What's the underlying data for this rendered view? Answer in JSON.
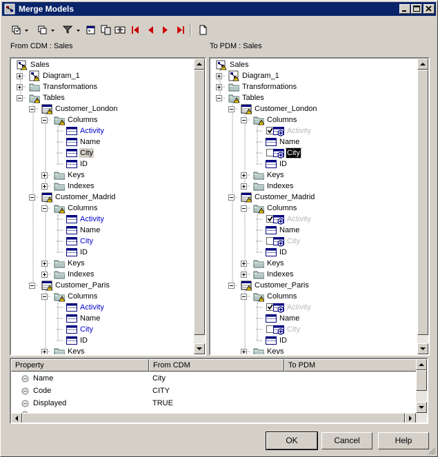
{
  "window": {
    "title": "Merge Models"
  },
  "panes": {
    "left_label": "From CDM : Sales",
    "right_label": "To PDM : Sales"
  },
  "left_tree": [
    {
      "label": "Sales",
      "level": 0,
      "icon": "model-warning-icon",
      "expander": "none"
    },
    {
      "label": "Diagram_1",
      "level": 1,
      "icon": "diagram-warning-icon",
      "expander": "plus"
    },
    {
      "label": "Transformations",
      "level": 1,
      "icon": "folder-icon",
      "expander": "plus"
    },
    {
      "label": "Tables",
      "level": 1,
      "icon": "folder-warning-icon",
      "expander": "minus"
    },
    {
      "label": "Customer_London",
      "level": 2,
      "icon": "table-warning-icon",
      "expander": "minus"
    },
    {
      "label": "Columns",
      "level": 3,
      "icon": "folder-warning-icon",
      "expander": "minus"
    },
    {
      "label": "Activity",
      "level": 4,
      "icon": "column-icon",
      "expander": "none",
      "style": "blue"
    },
    {
      "label": "Name",
      "level": 4,
      "icon": "column-icon",
      "expander": "none"
    },
    {
      "label": "City",
      "level": 4,
      "icon": "column-icon",
      "expander": "none",
      "style": "sel-gray"
    },
    {
      "label": "ID",
      "level": 4,
      "icon": "column-icon",
      "expander": "none"
    },
    {
      "label": "Keys",
      "level": 3,
      "icon": "folder-icon",
      "expander": "plus"
    },
    {
      "label": "Indexes",
      "level": 3,
      "icon": "folder-icon",
      "expander": "plus"
    },
    {
      "label": "Customer_Madrid",
      "level": 2,
      "icon": "table-warning-icon",
      "expander": "minus"
    },
    {
      "label": "Columns",
      "level": 3,
      "icon": "folder-warning-icon",
      "expander": "minus"
    },
    {
      "label": "Activity",
      "level": 4,
      "icon": "column-icon",
      "expander": "none",
      "style": "blue"
    },
    {
      "label": "Name",
      "level": 4,
      "icon": "column-icon",
      "expander": "none"
    },
    {
      "label": "City",
      "level": 4,
      "icon": "column-icon",
      "expander": "none",
      "style": "blue"
    },
    {
      "label": "ID",
      "level": 4,
      "icon": "column-icon",
      "expander": "none"
    },
    {
      "label": "Keys",
      "level": 3,
      "icon": "folder-icon",
      "expander": "plus"
    },
    {
      "label": "Indexes",
      "level": 3,
      "icon": "folder-icon",
      "expander": "plus"
    },
    {
      "label": "Customer_Paris",
      "level": 2,
      "icon": "table-warning-icon",
      "expander": "minus"
    },
    {
      "label": "Columns",
      "level": 3,
      "icon": "folder-warning-icon",
      "expander": "minus"
    },
    {
      "label": "Activity",
      "level": 4,
      "icon": "column-icon",
      "expander": "none",
      "style": "blue"
    },
    {
      "label": "Name",
      "level": 4,
      "icon": "column-icon",
      "expander": "none"
    },
    {
      "label": "City",
      "level": 4,
      "icon": "column-icon",
      "expander": "none",
      "style": "blue"
    },
    {
      "label": "ID",
      "level": 4,
      "icon": "column-icon",
      "expander": "none"
    },
    {
      "label": "Keys",
      "level": 3,
      "icon": "folder-icon",
      "expander": "plus"
    }
  ],
  "right_tree": [
    {
      "label": "Sales",
      "level": 0,
      "icon": "model-warning-icon",
      "expander": "none"
    },
    {
      "label": "Diagram_1",
      "level": 1,
      "icon": "diagram-warning-icon",
      "expander": "plus"
    },
    {
      "label": "Transformations",
      "level": 1,
      "icon": "folder-icon",
      "expander": "plus"
    },
    {
      "label": "Tables",
      "level": 1,
      "icon": "folder-warning-icon",
      "expander": "minus"
    },
    {
      "label": "Customer_London",
      "level": 2,
      "icon": "table-warning-icon",
      "expander": "minus"
    },
    {
      "label": "Columns",
      "level": 3,
      "icon": "folder-warning-icon",
      "expander": "minus"
    },
    {
      "label": "Activity",
      "level": 4,
      "icon": "column-add-icon",
      "expander": "none",
      "check": "checked",
      "style": "gray"
    },
    {
      "label": "Name",
      "level": 4,
      "icon": "column-icon",
      "expander": "none"
    },
    {
      "label": "City",
      "level": 4,
      "icon": "column-add-icon",
      "expander": "none",
      "check": "unchecked",
      "style": "sel-black"
    },
    {
      "label": "ID",
      "level": 4,
      "icon": "column-icon",
      "expander": "none"
    },
    {
      "label": "Keys",
      "level": 3,
      "icon": "folder-icon",
      "expander": "plus"
    },
    {
      "label": "Indexes",
      "level": 3,
      "icon": "folder-icon",
      "expander": "plus"
    },
    {
      "label": "Customer_Madrid",
      "level": 2,
      "icon": "table-warning-icon",
      "expander": "minus"
    },
    {
      "label": "Columns",
      "level": 3,
      "icon": "folder-warning-icon",
      "expander": "minus"
    },
    {
      "label": "Activity",
      "level": 4,
      "icon": "column-add-icon",
      "expander": "none",
      "check": "checked",
      "style": "gray"
    },
    {
      "label": "Name",
      "level": 4,
      "icon": "column-icon",
      "expander": "none"
    },
    {
      "label": "City",
      "level": 4,
      "icon": "column-add-icon",
      "expander": "none",
      "check": "unchecked",
      "style": "gray"
    },
    {
      "label": "ID",
      "level": 4,
      "icon": "column-icon",
      "expander": "none"
    },
    {
      "label": "Keys",
      "level": 3,
      "icon": "folder-icon",
      "expander": "plus"
    },
    {
      "label": "Indexes",
      "level": 3,
      "icon": "folder-icon",
      "expander": "plus"
    },
    {
      "label": "Customer_Paris",
      "level": 2,
      "icon": "table-warning-icon",
      "expander": "minus"
    },
    {
      "label": "Columns",
      "level": 3,
      "icon": "folder-warning-icon",
      "expander": "minus"
    },
    {
      "label": "Activity",
      "level": 4,
      "icon": "column-add-icon",
      "expander": "none",
      "check": "checked",
      "style": "gray"
    },
    {
      "label": "Name",
      "level": 4,
      "icon": "column-icon",
      "expander": "none"
    },
    {
      "label": "City",
      "level": 4,
      "icon": "column-add-icon",
      "expander": "none",
      "check": "unchecked",
      "style": "gray"
    },
    {
      "label": "ID",
      "level": 4,
      "icon": "column-icon",
      "expander": "none"
    },
    {
      "label": "Keys",
      "level": 3,
      "icon": "folder-icon",
      "expander": "plus"
    }
  ],
  "properties": {
    "headers": [
      "Property",
      "From CDM",
      "To PDM"
    ],
    "rows": [
      {
        "property": "Name",
        "from": "City",
        "to": ""
      },
      {
        "property": "Code",
        "from": "CITY",
        "to": ""
      },
      {
        "property": "Displayed",
        "from": "TRUE",
        "to": ""
      }
    ]
  },
  "buttons": {
    "ok": "OK",
    "cancel": "Cancel",
    "help": "Help"
  },
  "colors": {
    "titlebar": "#0a246a",
    "face": "#d4d0c8",
    "link_blue": "#0000cc",
    "nav_red": "#cc0000"
  }
}
